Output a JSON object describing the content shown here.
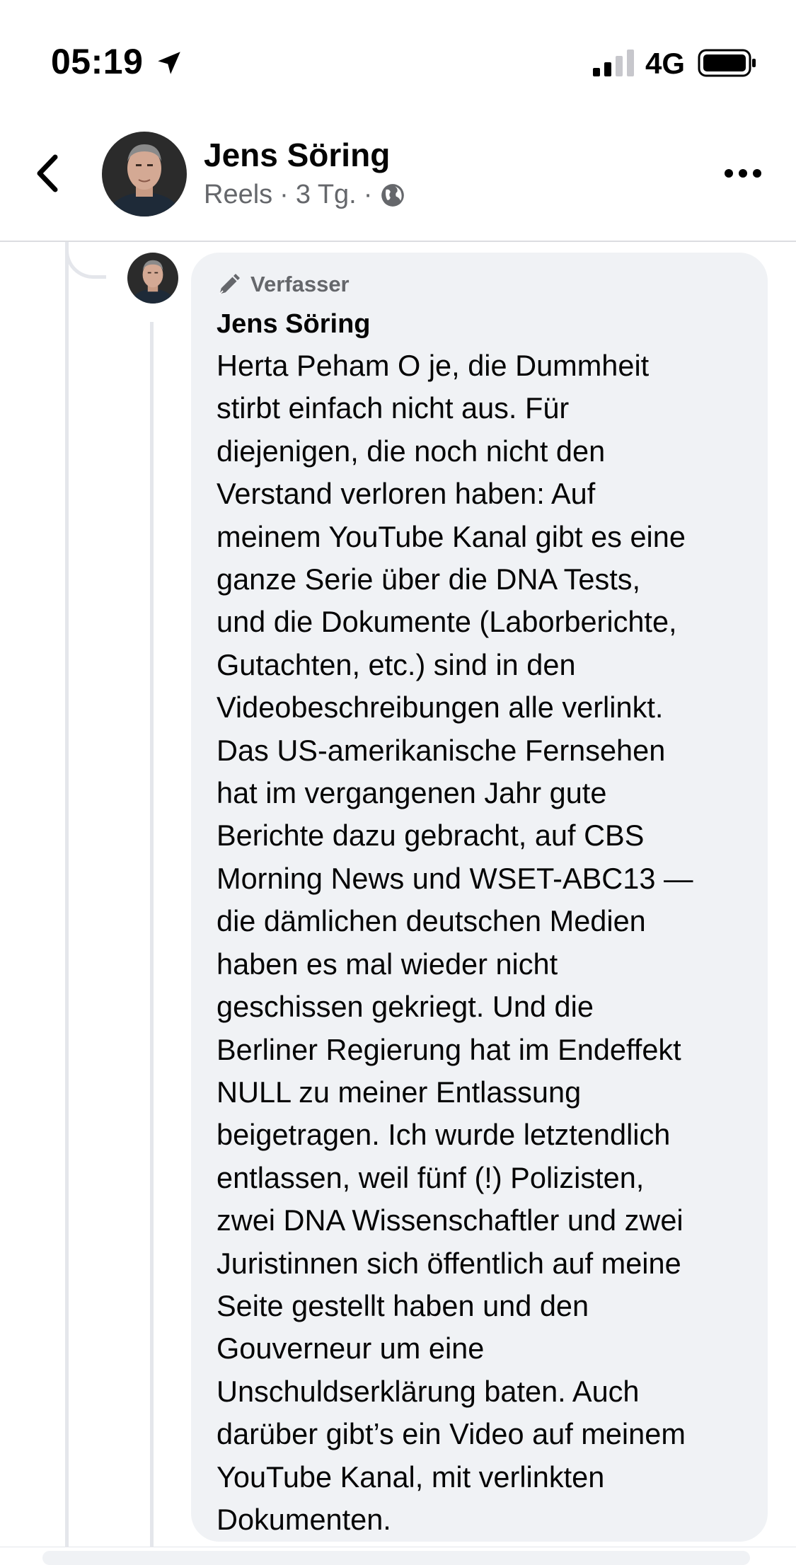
{
  "status_bar": {
    "time": "05:19",
    "network": "4G",
    "icons": [
      "location-arrow-icon",
      "signal-bars-icon",
      "battery-icon"
    ]
  },
  "header": {
    "name": "Jens Söring",
    "meta_source": "Reels",
    "meta_sep1": "·",
    "meta_time": "3 Tg.",
    "meta_sep2": "·",
    "icons": [
      "back-chevron-icon",
      "globe-icon",
      "more-dots-icon"
    ]
  },
  "comment": {
    "badge_label": "Verfasser",
    "badge_icon": "pen-icon",
    "author": "Jens Söring",
    "text_lines": [
      "Herta Peham O je, die Dummheit",
      "stirbt einfach nicht aus. Für",
      "diejenigen, die noch nicht den",
      "Verstand verloren haben: Auf",
      "meinem YouTube Kanal gibt es eine",
      "ganze Serie über die DNA Tests,",
      "und die Dokumente (Laborberichte,",
      "Gutachten, etc.) sind in den",
      "Videobeschreibungen alle verlinkt.",
      "Das US-amerikanische Fernsehen",
      "hat im vergangenen Jahr gute",
      "Berichte dazu gebracht, auf CBS",
      "Morning News und WSET-ABC13 —",
      "die dämlichen deutschen Medien",
      "haben es mal wieder nicht",
      "geschissen gekriegt. Und die",
      "Berliner Regierung hat im Endeffekt",
      "NULL zu meiner Entlassung",
      "beigetragen. Ich wurde letztendlich",
      "entlassen, weil fünf (!) Polizisten,",
      "zwei DNA Wissenschaftler und zwei",
      "Juristinnen sich öffentlich auf meine",
      "Seite gestellt haben und den",
      "Gouverneur um eine",
      "Unschuldserklärung baten. Auch",
      "darüber gibt’s ein Video auf meinem",
      "YouTube Kanal, mit verlinkten",
      "Dokumenten."
    ]
  },
  "colors": {
    "bubble_bg": "#f0f2f5",
    "secondary_text": "#65676b",
    "primary_text": "#050505",
    "thread_line": "#e4e6eb"
  }
}
